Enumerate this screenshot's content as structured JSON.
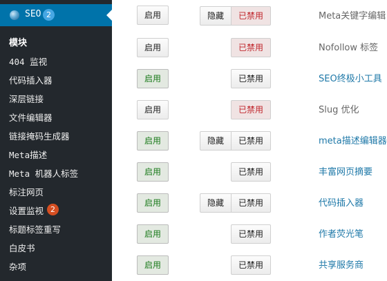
{
  "sidebar": {
    "header": {
      "label": "SEO",
      "badge": "2"
    },
    "section_title": "模块",
    "items": [
      {
        "label": "404 监视"
      },
      {
        "label": "代码插入器"
      },
      {
        "label": "深层链接"
      },
      {
        "label": "文件编辑器"
      },
      {
        "label": "链接掩码生成器"
      },
      {
        "label": "Meta描述"
      },
      {
        "label": "Meta 机器人标签"
      },
      {
        "label": "标注网页"
      },
      {
        "label": "设置监视",
        "badge": "2"
      },
      {
        "label": "标题标签重写"
      },
      {
        "label": "白皮书"
      },
      {
        "label": "杂项"
      }
    ]
  },
  "buttons": {
    "enable": "启用",
    "hide": "隐藏",
    "disable": "已禁用"
  },
  "modules": [
    {
      "label": "Meta关键字编辑"
    },
    {
      "label": "Nofollow 标签"
    },
    {
      "label": "SEO终极小工具"
    },
    {
      "label": "Slug 优化"
    },
    {
      "label": "meta描述编辑器"
    },
    {
      "label": "丰富网页摘要"
    },
    {
      "label": "代码插入器"
    },
    {
      "label": "作者荧光笔"
    },
    {
      "label": "共享服务商"
    }
  ]
}
